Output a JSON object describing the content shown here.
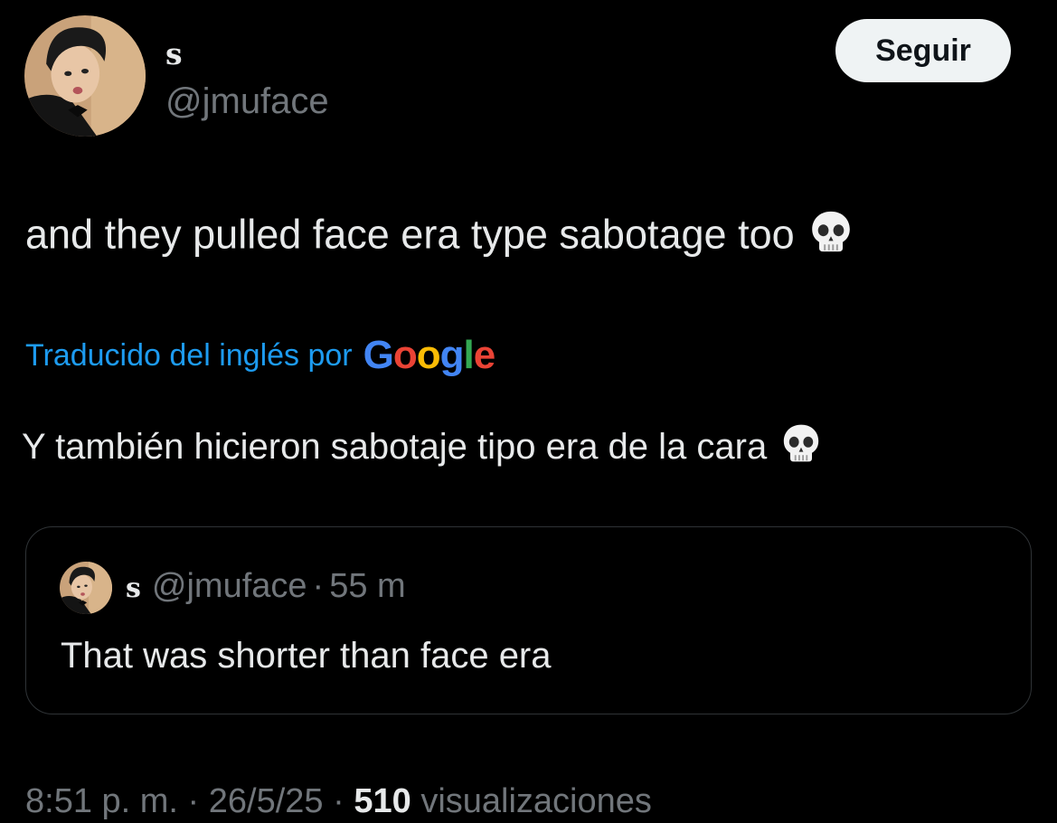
{
  "author": {
    "display_name": "s",
    "handle": "@jmuface"
  },
  "follow_button": {
    "label": "Seguir"
  },
  "tweet": {
    "text": "and they pulled face era type sabotage too",
    "emoji": "skull-emoji"
  },
  "translation": {
    "label": "Traducido del inglés por",
    "provider": "Google",
    "text": "Y también hicieron sabotaje tipo era de la cara",
    "emoji": "skull-emoji"
  },
  "quoted_tweet": {
    "display_name": "s",
    "handle": "@jmuface",
    "separator": "·",
    "time": "55 m",
    "text": "That was shorter than face era"
  },
  "meta": {
    "time": "8:51 p. m.",
    "date": "26/5/25",
    "separator": "·",
    "views_count": "510",
    "views_label": "visualizaciones"
  },
  "colors": {
    "background": "#000000",
    "text_primary": "#e7e9ea",
    "text_secondary": "#71767b",
    "link_blue": "#1d9bf0",
    "button_bg": "#eff3f4",
    "card_border": "#2f3336",
    "google_blue": "#4285f4",
    "google_red": "#ea4335",
    "google_yellow": "#fbbc05",
    "google_green": "#34a853"
  }
}
